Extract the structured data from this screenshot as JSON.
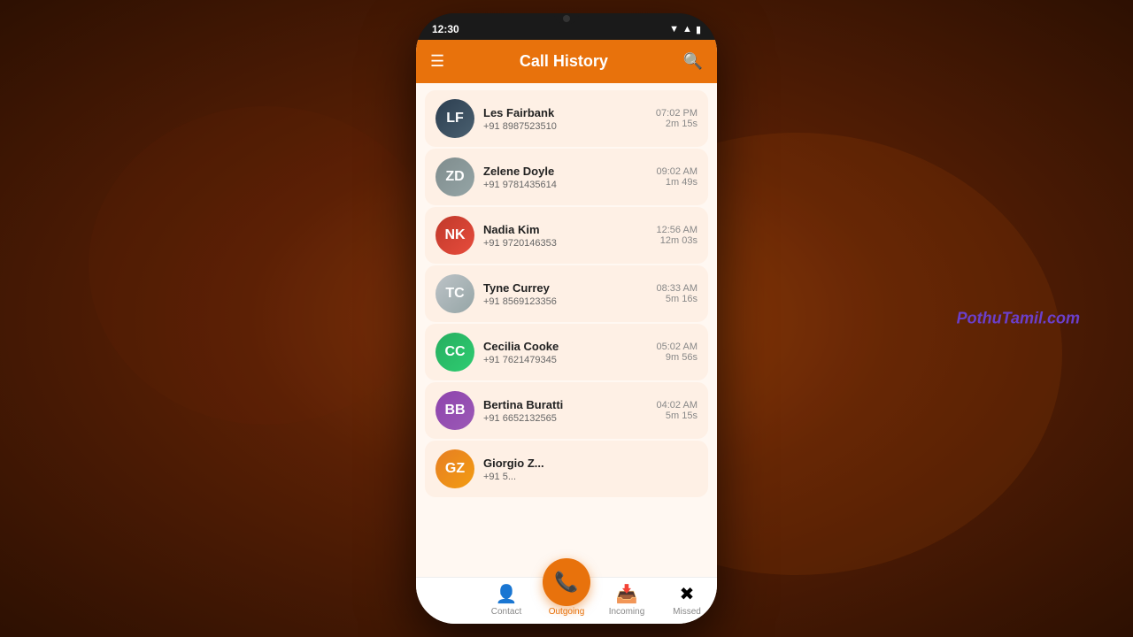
{
  "watermark": "PothuTamil.com",
  "phone": {
    "status_time": "12:30"
  },
  "header": {
    "title": "Call History"
  },
  "calls": [
    {
      "name": "Les Fairbank",
      "number": "+91 8987523510",
      "time": "07:02 PM",
      "duration": "2m 15s",
      "avatarClass": "av1",
      "initials": "LF"
    },
    {
      "name": "Zelene Doyle",
      "number": "+91 9781435614",
      "time": "09:02 AM",
      "duration": "1m 49s",
      "avatarClass": "av2",
      "initials": "ZD"
    },
    {
      "name": "Nadia Kim",
      "number": "+91 9720146353",
      "time": "12:56 AM",
      "duration": "12m 03s",
      "avatarClass": "av3",
      "initials": "NK"
    },
    {
      "name": "Tyne Currey",
      "number": "+91 8569123356",
      "time": "08:33 AM",
      "duration": "5m 16s",
      "avatarClass": "av4",
      "initials": "TC"
    },
    {
      "name": "Cecilia Cooke",
      "number": "+91 7621479345",
      "time": "05:02 AM",
      "duration": "9m 56s",
      "avatarClass": "av5",
      "initials": "CC"
    },
    {
      "name": "Bertina Buratti",
      "number": "+91 6652132565",
      "time": "04:02 AM",
      "duration": "5m 15s",
      "avatarClass": "av6",
      "initials": "BB"
    },
    {
      "name": "Giorgio Z...",
      "number": "+91 5...",
      "time": "",
      "duration": "",
      "avatarClass": "av7",
      "initials": "GZ"
    }
  ],
  "bottomNav": {
    "items": [
      {
        "label": "Contact",
        "icon": "👤",
        "active": false
      },
      {
        "label": "Outgoing",
        "icon": "📞",
        "active": true
      },
      {
        "label": "Incoming",
        "icon": "📲",
        "active": false
      },
      {
        "label": "Missed",
        "icon": "📵",
        "active": false
      }
    ],
    "fab_icon": "📞"
  }
}
